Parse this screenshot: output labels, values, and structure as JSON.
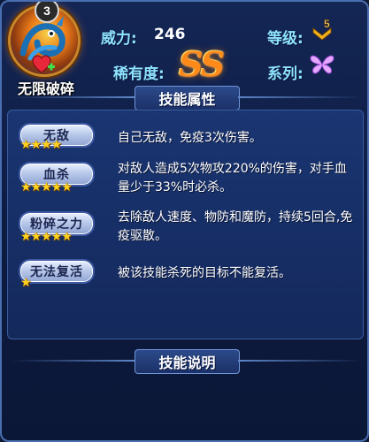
{
  "hero": {
    "level": "3",
    "name": "无限破碎",
    "portrait_icon": "dragon-hero-portrait",
    "element_icon": "heart-plus-icon"
  },
  "stats": {
    "power_label": "威力:",
    "power_value": "246",
    "grade_label": "等级:",
    "grade_value": "5",
    "rarity_label": "稀有度:",
    "rarity_value": "SS",
    "series_label": "系列:",
    "series_icon": "butterfly-icon"
  },
  "sections": {
    "attributes_title": "技能属性",
    "description_title": "技能说明"
  },
  "skills": [
    {
      "name": "无敌",
      "stars": 4,
      "description": "自己无敌，免疫3次伤害。"
    },
    {
      "name": "血杀",
      "stars": 5,
      "description": "对敌人造成5次物攻220%的伤害，对手血量少于33%时必杀。"
    },
    {
      "name": "粉碎之力",
      "stars": 5,
      "description": "去除敌人速度、物防和魔防，持续5回合,免疫驱散。"
    },
    {
      "name": "无法复活",
      "stars": 1,
      "description": "被该技能杀死的目标不能复活。"
    }
  ],
  "colors": {
    "label_cyan": "#8ee3ff",
    "star_gold": "#ffd21e",
    "rarity_orange": "#ff8a1a"
  }
}
